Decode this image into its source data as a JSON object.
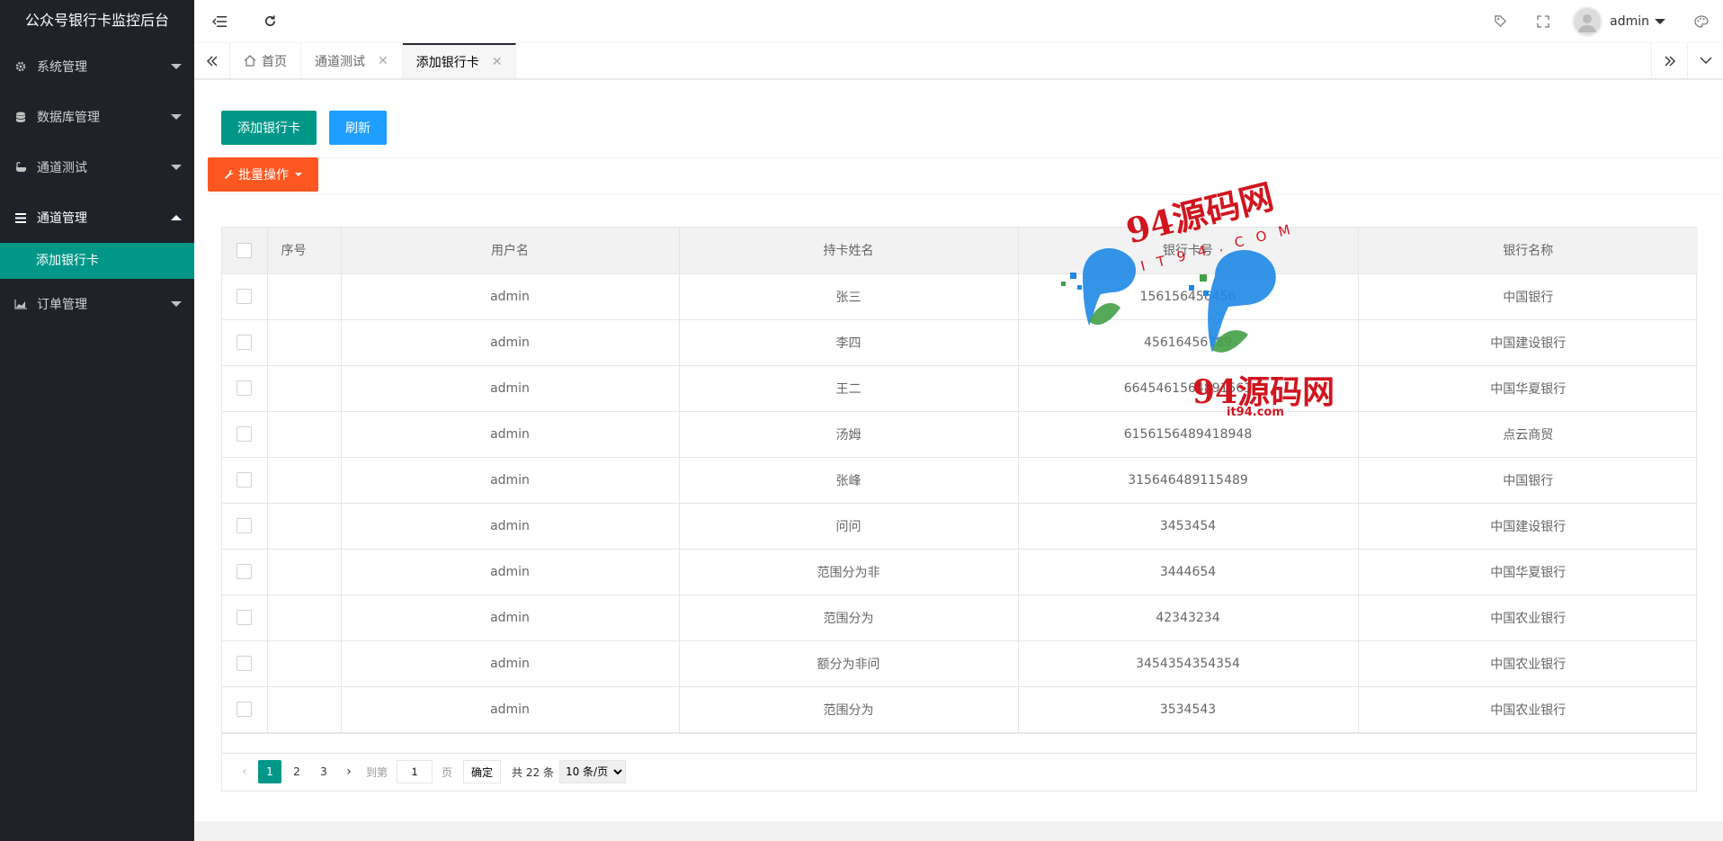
{
  "sidebar": {
    "title": "公众号银行卡监控后台",
    "items": [
      {
        "label": "系统管理",
        "icon": "gear-icon"
      },
      {
        "label": "数据库管理",
        "icon": "database-icon"
      },
      {
        "label": "通道测试",
        "icon": "bathtub-icon"
      },
      {
        "label": "通道管理",
        "icon": "list-icon"
      },
      {
        "label": "订单管理",
        "icon": "area-chart-icon"
      }
    ],
    "submenu_label": "添加银行卡"
  },
  "topbar": {
    "username": "admin"
  },
  "tabs": [
    {
      "label": "首页"
    },
    {
      "label": "通道测试"
    },
    {
      "label": "添加银行卡"
    }
  ],
  "toolbar": {
    "add_label": "添加银行卡",
    "refresh_label": "刷新",
    "batch_label": "批量操作"
  },
  "table": {
    "headers": [
      "序号",
      "用户名",
      "持卡姓名",
      "银行卡号",
      "银行名称"
    ],
    "rows": [
      {
        "user": "admin",
        "name": "张三",
        "card": "156156456456",
        "bank": "中国银行"
      },
      {
        "user": "admin",
        "name": "李四",
        "card": "45616456789",
        "bank": "中国建设银行"
      },
      {
        "user": "admin",
        "name": "王二",
        "card": "6645461564891561",
        "bank": "中国华夏银行"
      },
      {
        "user": "admin",
        "name": "汤姆",
        "card": "6156156489418948",
        "bank": "点云商贸"
      },
      {
        "user": "admin",
        "name": "张峰",
        "card": "315646489115489",
        "bank": "中国银行"
      },
      {
        "user": "admin",
        "name": "问问",
        "card": "3453454",
        "bank": "中国建设银行"
      },
      {
        "user": "admin",
        "name": "范围分为非",
        "card": "3444654",
        "bank": "中国华夏银行"
      },
      {
        "user": "admin",
        "name": "范围分为",
        "card": "42343234",
        "bank": "中国农业银行"
      },
      {
        "user": "admin",
        "name": "额分为非问",
        "card": "3454354354354",
        "bank": "中国农业银行"
      },
      {
        "user": "admin",
        "name": "范围分为",
        "card": "3534543",
        "bank": "中国农业银行"
      }
    ]
  },
  "pager": {
    "pages": [
      "1",
      "2",
      "3"
    ],
    "current": "1",
    "goto_label": "到第",
    "goto_value": "1",
    "page_unit": "页",
    "confirm_label": "确定",
    "total_label": "共 22 条",
    "per_page": "10 条/页"
  },
  "watermark": {
    "text1": "94源码网",
    "text2": "IT94.COM",
    "text3": "94源码网",
    "text4": "it94.com"
  }
}
